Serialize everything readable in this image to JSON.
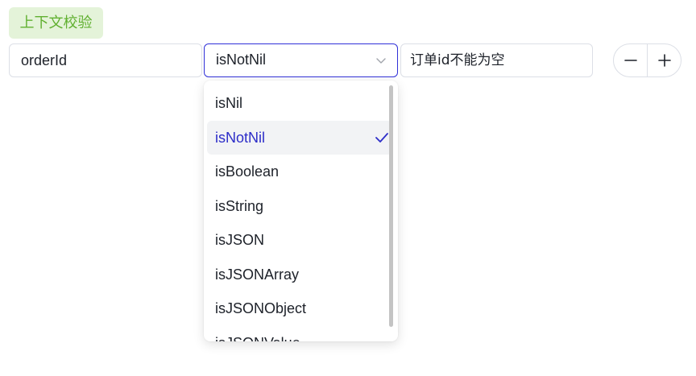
{
  "section_tag": "上下文校验",
  "rule": {
    "key_value": "orderId",
    "validator_selected": "isNotNil",
    "message_value": "订单id不能为空"
  },
  "stepper": {
    "minus_icon": "minus-icon",
    "plus_icon": "plus-icon"
  },
  "dropdown": {
    "options": [
      {
        "label": "isNil"
      },
      {
        "label": "isNotNil"
      },
      {
        "label": "isBoolean"
      },
      {
        "label": "isString"
      },
      {
        "label": "isJSON"
      },
      {
        "label": "isJSONArray"
      },
      {
        "label": "isJSONObject"
      },
      {
        "label": "isJSONValue"
      }
    ],
    "selected_index": 1
  },
  "colors": {
    "accent": "#3030d8",
    "tag_bg": "#e4f3d9",
    "tag_text": "#60b030"
  }
}
